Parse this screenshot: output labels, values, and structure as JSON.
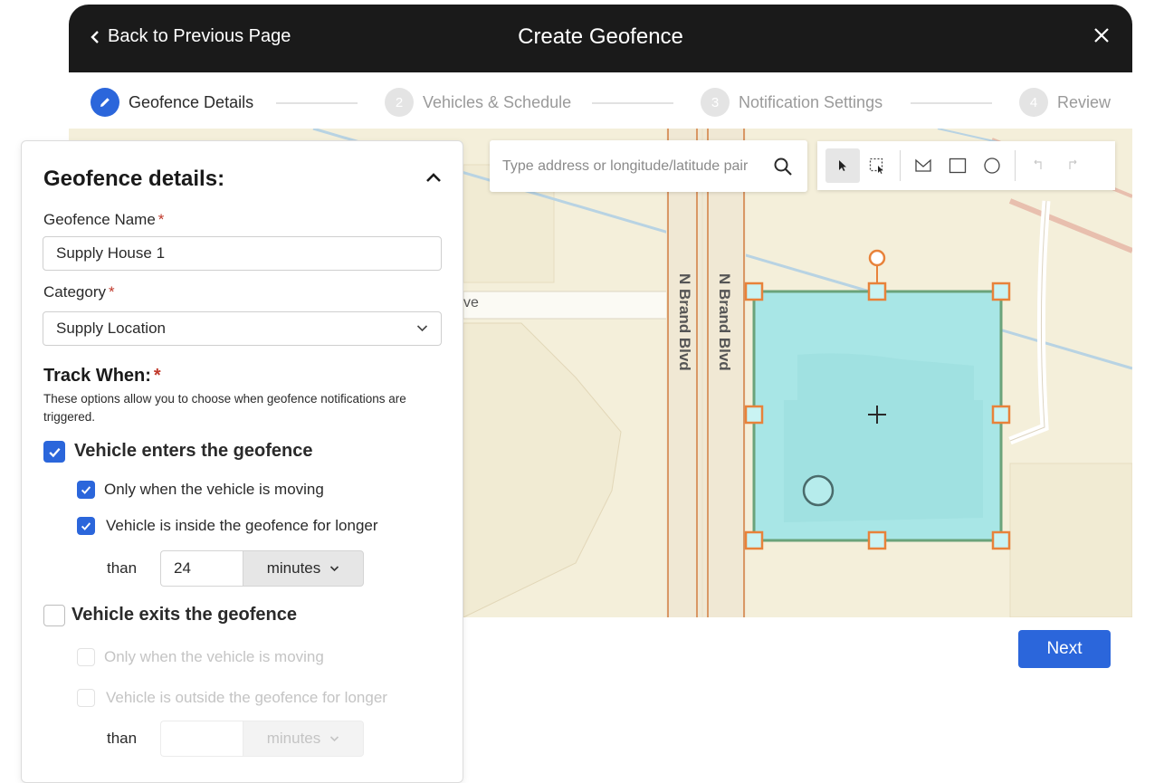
{
  "header": {
    "back_label": "Back to Previous Page",
    "title": "Create Geofence"
  },
  "stepper": {
    "steps": [
      {
        "number": "1",
        "label": "Geofence Details",
        "active": true
      },
      {
        "number": "2",
        "label": "Vehicles & Schedule",
        "active": false
      },
      {
        "number": "3",
        "label": "Notification Settings",
        "active": false
      },
      {
        "number": "4",
        "label": "Review",
        "active": false
      }
    ]
  },
  "map": {
    "search_placeholder": "Type address or longitude/latitude pair",
    "street_labels": [
      "N Brand Blvd",
      "N Brand Blvd",
      "ve"
    ],
    "toolbar_tools": [
      "select-icon",
      "box-select-icon",
      "polygon-icon",
      "rectangle-icon",
      "circle-icon",
      "undo-icon",
      "redo-icon"
    ],
    "colors": {
      "geofence_fill": "#a8e6e6",
      "geofence_stroke": "#6aa37a",
      "handle": "#e8823a",
      "road": "#d99865"
    }
  },
  "panel": {
    "title": "Geofence details:",
    "name_label": "Geofence Name",
    "name_value": "Supply House 1",
    "category_label": "Category",
    "category_value": "Supply Location",
    "track_title": "Track When:",
    "track_desc": "These options allow you to choose when geofence notifications are triggered.",
    "enters": {
      "label": "Vehicle enters the geofence",
      "checked": true,
      "moving_label": "Only when the vehicle is moving",
      "moving_checked": true,
      "inside_label": "Vehicle is inside the geofence for longer",
      "inside_checked": true,
      "than_label": "than",
      "duration": "24",
      "unit": "minutes"
    },
    "exits": {
      "label": "Vehicle exits the geofence",
      "checked": false,
      "moving_label": "Only when the vehicle is moving",
      "outside_label": "Vehicle is outside the geofence for longer",
      "than_label": "than",
      "duration": "",
      "unit": "minutes"
    }
  },
  "next_label": "Next"
}
